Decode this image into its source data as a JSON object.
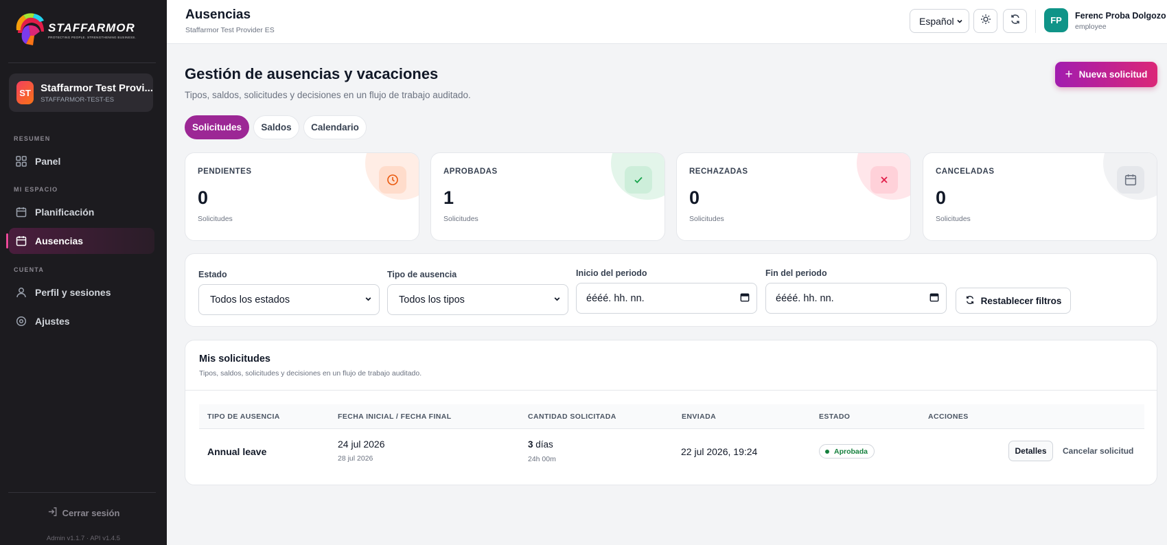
{
  "sidebar": {
    "brand": {
      "name": "STAFFARMOR",
      "tagline": "PROTECTING PEOPLE. STRENGTHENING BUSINESS."
    },
    "tenant": {
      "initials": "ST",
      "name": "Staffarmor Test Provi...",
      "code": "STAFFARMOR-TEST-ES"
    },
    "sections": {
      "resumen": "RESUMEN",
      "mi_espacio": "MI ESPACIO",
      "cuenta": "CUENTA"
    },
    "items": {
      "panel": "Panel",
      "planificacion": "Planificación",
      "ausencias": "Ausencias",
      "perfil": "Perfil y sesiones",
      "ajustes": "Ajustes"
    },
    "logout": "Cerrar sesión",
    "version": "Admin v1.1.7 · API v1.4.5"
  },
  "header": {
    "title": "Ausencias",
    "subtitle": "Staffarmor Test Provider ES",
    "language": "Español",
    "user": {
      "initials": "FP",
      "name": "Ferenc Proba Dolgozo",
      "role": "employee"
    }
  },
  "main": {
    "title": "Gestión de ausencias y vacaciones",
    "subtitle": "Tipos, saldos, solicitudes y decisiones en un flujo de trabajo auditado.",
    "new_request": "Nueva solicitud",
    "tabs": [
      "Solicitudes",
      "Saldos",
      "Calendario"
    ],
    "stats": [
      {
        "label": "PENDIENTES",
        "value": "0",
        "unit": "Solicitudes",
        "color": "#ea580c"
      },
      {
        "label": "APROBADAS",
        "value": "1",
        "unit": "Solicitudes",
        "color": "#16a34a"
      },
      {
        "label": "RECHAZADAS",
        "value": "0",
        "unit": "Solicitudes",
        "color": "#e11d48"
      },
      {
        "label": "CANCELADAS",
        "value": "0",
        "unit": "Solicitudes",
        "color": "#6b7280"
      }
    ],
    "filters": {
      "estado_label": "Estado",
      "estado_value": "Todos los estados",
      "tipo_label": "Tipo de ausencia",
      "tipo_value": "Todos los tipos",
      "inicio_label": "Inicio del periodo",
      "inicio_placeholder": "éééé. hh. nn.",
      "fin_label": "Fin del periodo",
      "fin_placeholder": "éééé. hh. nn.",
      "reset": "Restablecer filtros"
    },
    "requests": {
      "title": "Mis solicitudes",
      "subtitle": "Tipos, saldos, solicitudes y decisiones en un flujo de trabajo auditado.",
      "columns": [
        "TIPO DE AUSENCIA",
        "FECHA INICIAL / FECHA FINAL",
        "CANTIDAD SOLICITADA",
        "ENVIADA",
        "ESTADO",
        "ACCIONES"
      ],
      "rows": [
        {
          "type": "Annual leave",
          "start": "24 jul 2026",
          "end": "28 jul 2026",
          "amount": "3",
          "amount_unit": "días",
          "hours": "24h 00m",
          "sent": "22 jul 2026, 19:24",
          "status": "Aprobada",
          "details": "Detalles",
          "cancel": "Cancelar solicitud"
        }
      ]
    }
  }
}
